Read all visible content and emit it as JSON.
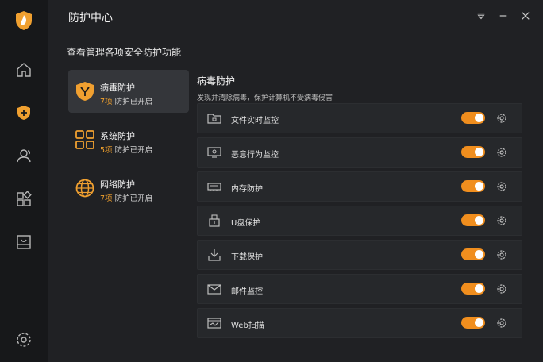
{
  "window": {
    "title": "防护中心"
  },
  "header": {
    "subtitle": "查看管理各项安全防护功能"
  },
  "sidebar": {
    "items": [
      {
        "icon": "home-icon"
      },
      {
        "icon": "shield-plus-icon"
      },
      {
        "icon": "users-icon"
      },
      {
        "icon": "apps-icon"
      },
      {
        "icon": "box-icon"
      },
      {
        "icon": "settings-icon"
      }
    ]
  },
  "categories": [
    {
      "name": "病毒防护",
      "count": "7项",
      "status": "防护已开启",
      "active": true
    },
    {
      "name": "系统防护",
      "count": "5项",
      "status": "防护已开启",
      "active": false
    },
    {
      "name": "网络防护",
      "count": "7项",
      "status": "防护已开启",
      "active": false
    }
  ],
  "panel": {
    "title": "病毒防护",
    "description": "发现并清除病毒，保护计算机不受病毒侵害",
    "rows": [
      {
        "label": "文件实时监控",
        "icon": "folder-icon",
        "enabled": true
      },
      {
        "label": "恶意行为监控",
        "icon": "eye-monitor-icon",
        "enabled": true
      },
      {
        "label": "内存防护",
        "icon": "memory-icon",
        "enabled": true
      },
      {
        "label": "U盘保护",
        "icon": "usb-icon",
        "enabled": true
      },
      {
        "label": "下载保护",
        "icon": "download-icon",
        "enabled": true
      },
      {
        "label": "邮件监控",
        "icon": "mail-icon",
        "enabled": true
      },
      {
        "label": "Web扫描",
        "icon": "web-icon",
        "enabled": true
      }
    ]
  },
  "colors": {
    "accent": "#f08e1e",
    "background": "#202124",
    "sidebar": "#17181a"
  }
}
